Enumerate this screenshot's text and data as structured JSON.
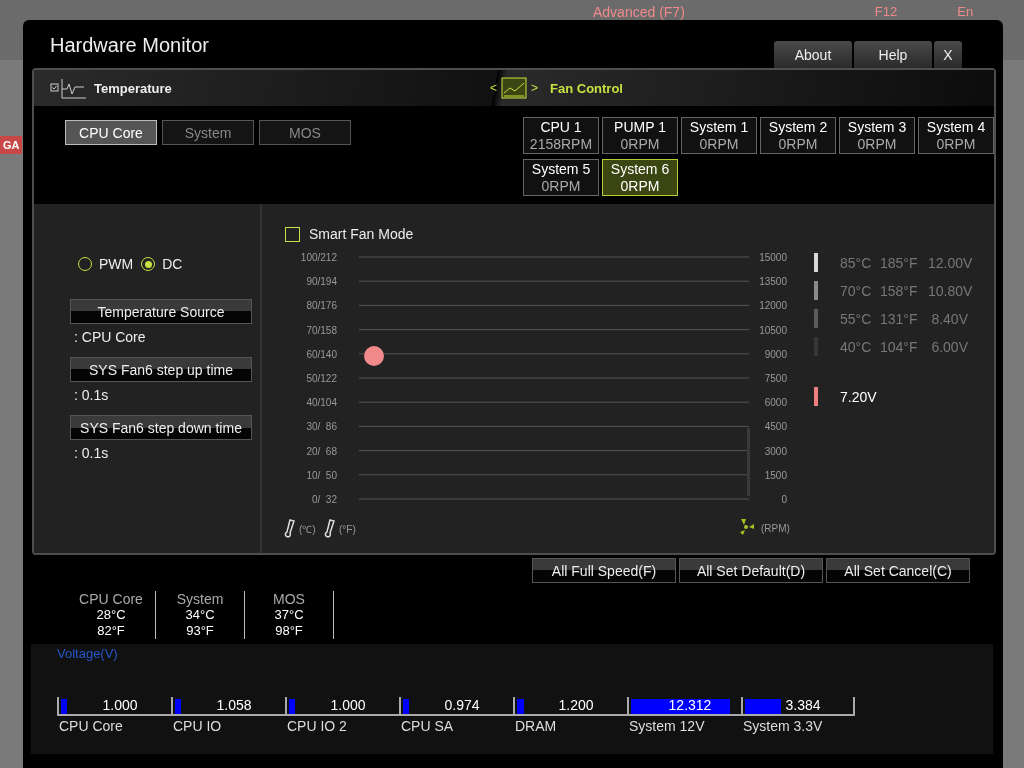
{
  "background": {
    "menu_title": "Advanced (F7)",
    "key_hint": "F12",
    "language": "En",
    "side_tab": "GA"
  },
  "window": {
    "title": "Hardware Monitor",
    "tabs": [
      {
        "label": "About"
      },
      {
        "label": "Help"
      },
      {
        "label": "X"
      }
    ]
  },
  "sections": {
    "temperature": "Temperature",
    "fan_control": "Fan Control",
    "fan_nav_prev": "<",
    "fan_nav_next": ">"
  },
  "sensors": [
    {
      "label": "CPU Core",
      "selected": true
    },
    {
      "label": "System",
      "selected": false
    },
    {
      "label": "MOS",
      "selected": false
    }
  ],
  "fans": [
    {
      "name": "CPU 1",
      "speed": "2158RPM",
      "selected": false
    },
    {
      "name": "PUMP 1",
      "speed": "0RPM",
      "selected": false
    },
    {
      "name": "System 1",
      "speed": "0RPM",
      "selected": false
    },
    {
      "name": "System 2",
      "speed": "0RPM",
      "selected": false
    },
    {
      "name": "System 3",
      "speed": "0RPM",
      "selected": false
    },
    {
      "name": "System 4",
      "speed": "0RPM",
      "selected": false
    },
    {
      "name": "System 5",
      "speed": "0RPM",
      "selected": false
    },
    {
      "name": "System 6",
      "speed": "0RPM",
      "selected": true
    }
  ],
  "fan_settings": {
    "modes": [
      {
        "label": "PWM",
        "selected": false
      },
      {
        "label": "DC",
        "selected": true
      }
    ],
    "options": [
      {
        "label": "Temperature Source",
        "value": ": CPU Core"
      },
      {
        "label": "SYS Fan6 step up time",
        "value": ": 0.1s"
      },
      {
        "label": "SYS Fan6 step down time",
        "value": ": 0.1s"
      }
    ]
  },
  "curve": {
    "smart_fan_mode": {
      "label": "Smart Fan Mode",
      "checked": false
    },
    "temp_ticks": [
      "100/212",
      "90/194",
      "80/176",
      "70/158",
      "60/140",
      "50/122",
      "40/104",
      "30/  86",
      "20/  68",
      "10/  50",
      "0/  32"
    ],
    "rpm_ticks": [
      "15000",
      "13500",
      "12000",
      "10500",
      "9000",
      "7500",
      "6000",
      "4500",
      "3000",
      "1500",
      "0"
    ],
    "temp_unit_c": "(℃)",
    "temp_unit_f": "(°F)",
    "rpm_unit": "(RPM)",
    "legend": [
      {
        "celsius": "85°C",
        "fahrenheit": "185°F",
        "voltage": "12.00V",
        "color": "#d8d8d8"
      },
      {
        "celsius": "70°C",
        "fahrenheit": "158°F",
        "voltage": "10.80V",
        "color": "#8c8c8c"
      },
      {
        "celsius": "55°C",
        "fahrenheit": "131°F",
        "voltage": "8.40V",
        "color": "#5c5c5c"
      },
      {
        "celsius": "40°C",
        "fahrenheit": "104°F",
        "voltage": "6.00V",
        "color": "#363636"
      }
    ],
    "current": {
      "voltage": "7.20V",
      "color": "#f08080"
    }
  },
  "actions": [
    "All Full Speed(F)",
    "All Set Default(D)",
    "All Set Cancel(C)"
  ],
  "readings": [
    {
      "name": "CPU Core",
      "celsius": "28°C",
      "fahrenheit": "82°F"
    },
    {
      "name": "System",
      "celsius": "34°C",
      "fahrenheit": "93°F"
    },
    {
      "name": "MOS",
      "celsius": "37°C",
      "fahrenheit": "98°F"
    }
  ],
  "voltage": {
    "title": "Voltage(V)",
    "rails": [
      {
        "name": "CPU Core",
        "value": "1.000",
        "level": 0.05
      },
      {
        "name": "CPU IO",
        "value": "1.058",
        "level": 0.05
      },
      {
        "name": "CPU IO 2",
        "value": "1.000",
        "level": 0.05
      },
      {
        "name": "CPU SA",
        "value": "0.974",
        "level": 0.05
      },
      {
        "name": "DRAM",
        "value": "1.200",
        "level": 0.06
      },
      {
        "name": "System 12V",
        "value": "12.312",
        "level": 0.88
      },
      {
        "name": "System 3.3V",
        "value": "3.384",
        "level": 0.33
      }
    ]
  }
}
